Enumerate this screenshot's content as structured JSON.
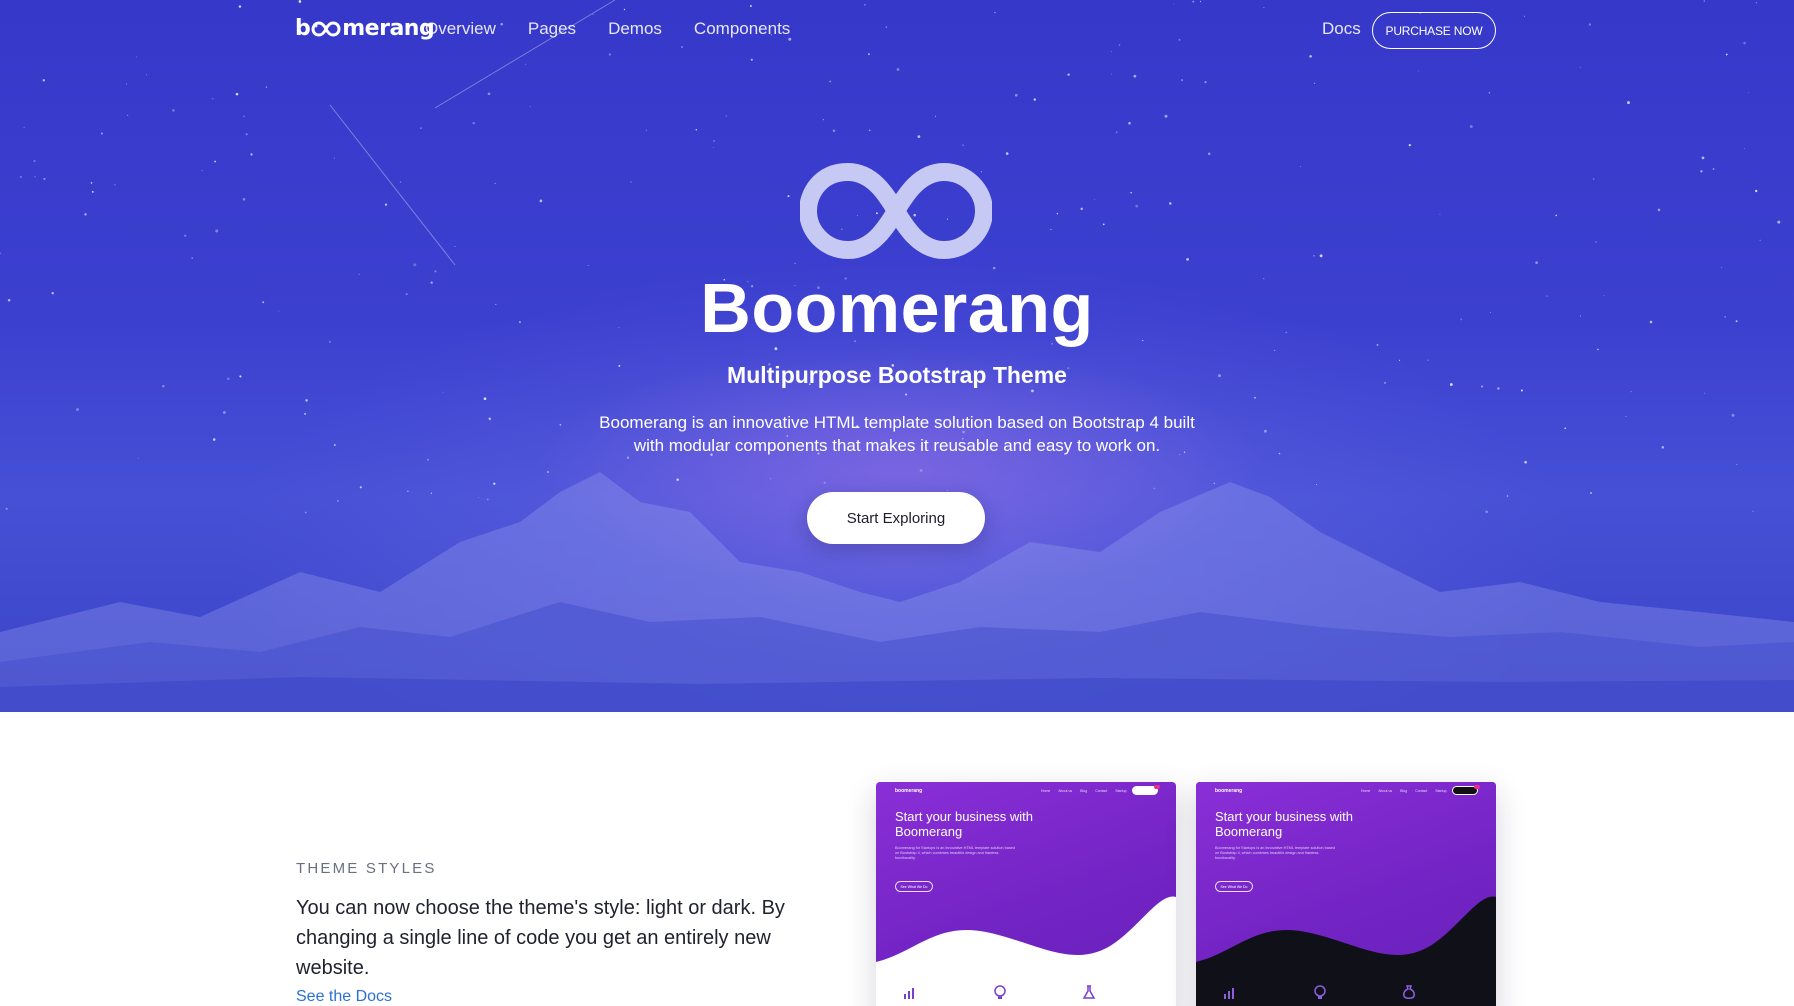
{
  "nav": {
    "brand": {
      "left": "b",
      "right": "merang"
    },
    "links": [
      "Overview",
      "Pages",
      "Demos",
      "Components"
    ],
    "docs": "Docs",
    "purchase": "PURCHASE NOW"
  },
  "hero": {
    "logo_icon": "infinity-loop-icon",
    "title": "Boomerang",
    "subtitle": "Multipurpose Bootstrap Theme",
    "description": "Boomerang is an innovative HTML template solution based on Bootstrap 4 built with modular components that makes it reusable and easy to work on.",
    "cta": "Start Exploring"
  },
  "section": {
    "eyebrow": "THEME STYLES",
    "text": "You can now choose the theme's style: light or dark. By changing a single line of code you get an entirely new website.",
    "link": "See the Docs"
  },
  "preview_cards": [
    {
      "variant": "light",
      "brand": "boomerang",
      "nav": [
        "Home",
        "About us",
        "Blog",
        "Contact",
        "Startup"
      ],
      "title": "Start your business with Boomerang",
      "body": "Boomerang for Startups is an innovative HTML template solution based on Bootstrap 4, which combines beautiful design and flawless functionality.",
      "button": "See What We Do"
    },
    {
      "variant": "dark",
      "brand": "boomerang",
      "nav": [
        "Home",
        "About us",
        "Blog",
        "Contact",
        "Startup"
      ],
      "title": "Start your business with Boomerang",
      "body": "Boomerang for Startups is an innovative HTML template solution based on Bootstrap 4, which combines beautiful design and flawless functionality.",
      "button": "See What We Do"
    }
  ],
  "colors": {
    "hero_bg": "#3c40cf",
    "accent_purple": "#7a28c8",
    "link_blue": "#2b70d6",
    "pink": "#ec2f83"
  }
}
